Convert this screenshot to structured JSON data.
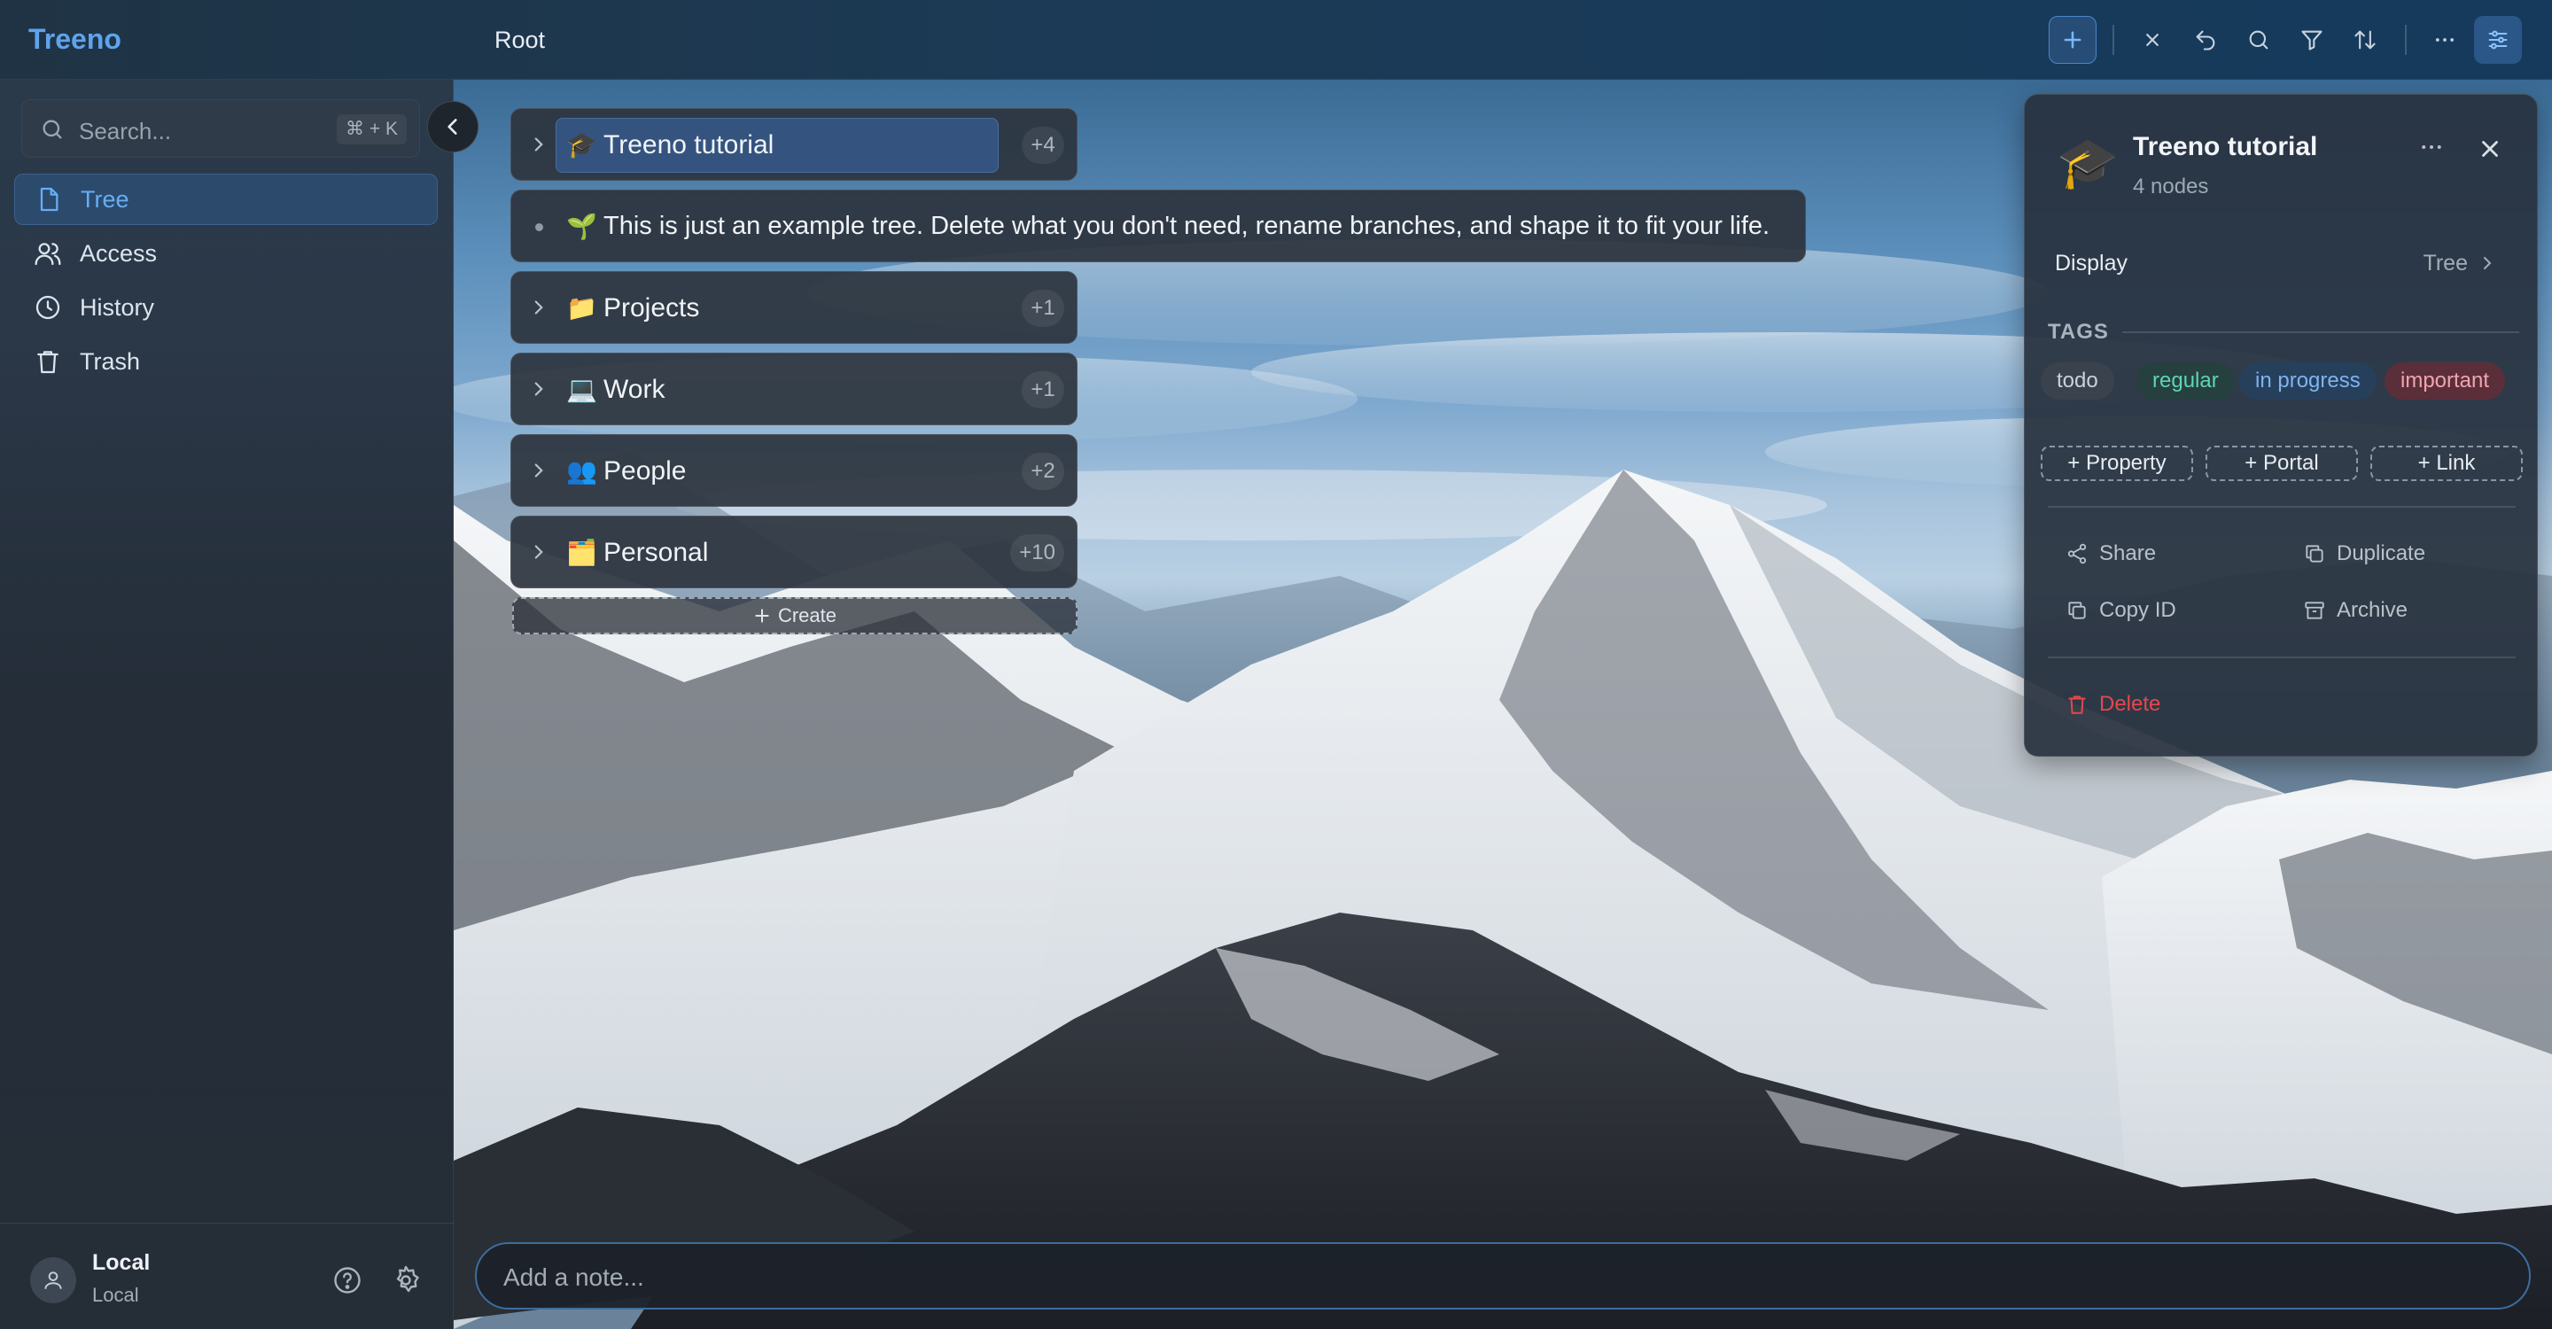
{
  "app": {
    "brand": "Treeno"
  },
  "breadcrumb": {
    "root": "Root"
  },
  "toolbar": {
    "icons": [
      "plus-icon",
      "close-icon",
      "undo-icon",
      "search-icon",
      "filter-icon",
      "sort-icon",
      "more-icon",
      "sliders-icon"
    ]
  },
  "sidebar": {
    "search_placeholder": "Search...",
    "search_shortcut": "⌘ + K",
    "items": [
      {
        "label": "Tree",
        "icon": "file-icon",
        "active": true
      },
      {
        "label": "Access",
        "icon": "users-icon",
        "active": false
      },
      {
        "label": "History",
        "icon": "clock-icon",
        "active": false
      },
      {
        "label": "Trash",
        "icon": "trash-icon",
        "active": false
      }
    ],
    "user": {
      "name": "Local",
      "sub": "Local"
    }
  },
  "tree": {
    "nodes": [
      {
        "emoji": "🎓",
        "label": "Treeno tutorial",
        "count": "+4",
        "selected": true
      },
      {
        "emoji": "📁",
        "label": "Projects",
        "count": "+1"
      },
      {
        "emoji": "💻",
        "label": "Work",
        "count": "+1"
      },
      {
        "emoji": "👥",
        "label": "People",
        "count": "+2"
      },
      {
        "emoji": "🗂️",
        "label": "Personal",
        "count": "+10"
      }
    ],
    "note": {
      "emoji": "🌱",
      "text": "This is just an example tree. Delete what you don't need, rename branches, and shape it to fit your life."
    },
    "create_label": "Create"
  },
  "panel": {
    "icon": "🎓",
    "title": "Treeno tutorial",
    "subtitle": "4 nodes",
    "display_label": "Display",
    "display_value": "Tree",
    "tags_heading": "TAGS",
    "tags": [
      {
        "label": "todo",
        "color": "#c9d1d9",
        "bg": "#3a434d"
      },
      {
        "label": "regular",
        "color": "#5fd3b6",
        "bg": "#25403f"
      },
      {
        "label": "in progress",
        "color": "#7fb3f0",
        "bg": "#26405c"
      },
      {
        "label": "important",
        "color": "#f0a4b0",
        "bg": "#5b2f3a"
      }
    ],
    "add_buttons": [
      "+ Property",
      "+ Portal",
      "+ Link"
    ],
    "actions": {
      "share": "Share",
      "duplicate": "Duplicate",
      "copy_id": "Copy ID",
      "archive": "Archive",
      "delete": "Delete"
    },
    "delete_color": "#e5484d"
  },
  "note_input": {
    "placeholder": "Add a note..."
  },
  "colors": {
    "accent": "#5fa3ec",
    "active_nav_bg": "#2b4a6c"
  }
}
